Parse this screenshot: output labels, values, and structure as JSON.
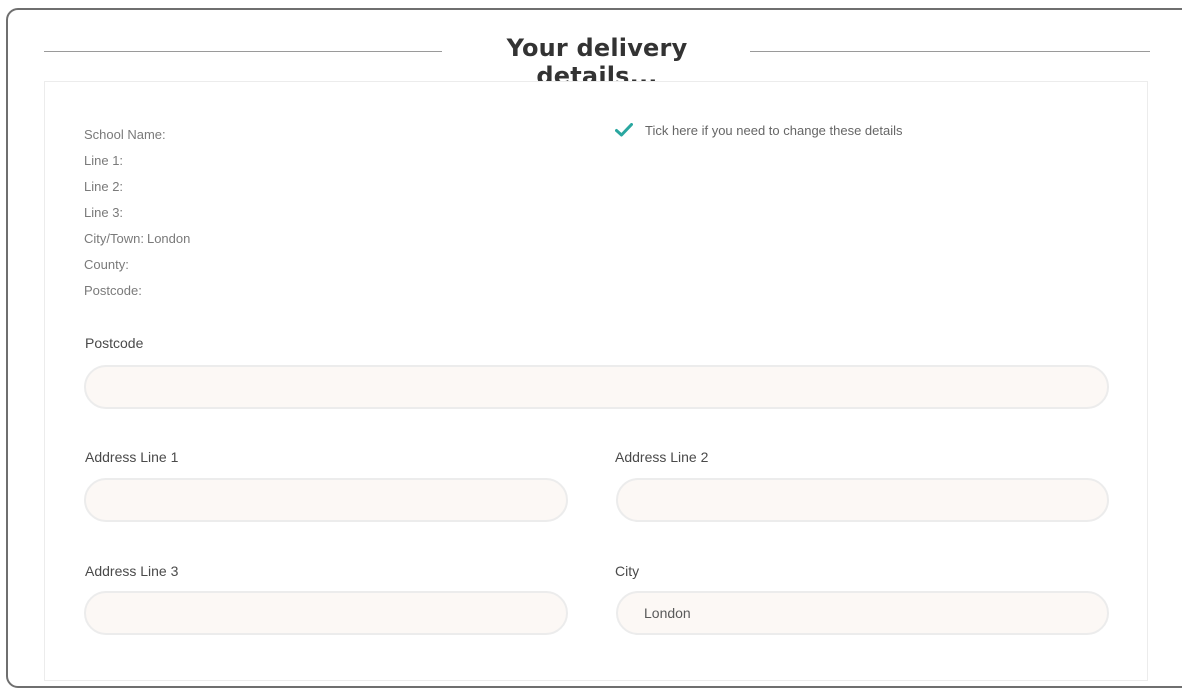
{
  "header": {
    "title": "Your delivery details..."
  },
  "summary": [
    {
      "label": "School Name:",
      "value": ""
    },
    {
      "label": "Line 1:",
      "value": ""
    },
    {
      "label": "Line 2:",
      "value": ""
    },
    {
      "label": "Line 3:",
      "value": ""
    },
    {
      "label": "City/Town:",
      "value": "London"
    },
    {
      "label": "County:",
      "value": ""
    },
    {
      "label": "Postcode:",
      "value": ""
    }
  ],
  "change_toggle": {
    "label": "Tick here if you need to change these details",
    "checked": true,
    "icon": "checkmark-icon",
    "color": "#2aa7a0"
  },
  "form": {
    "postcode": {
      "label": "Postcode",
      "value": ""
    },
    "address_line_1": {
      "label": "Address Line 1",
      "value": ""
    },
    "address_line_2": {
      "label": "Address Line 2",
      "value": ""
    },
    "address_line_3": {
      "label": "Address Line 3",
      "value": ""
    },
    "city": {
      "label": "City",
      "value": "London"
    }
  },
  "colors": {
    "input_background": "#fcf8f5",
    "input_border": "#ececec",
    "frame_border": "#6f6f6f"
  }
}
